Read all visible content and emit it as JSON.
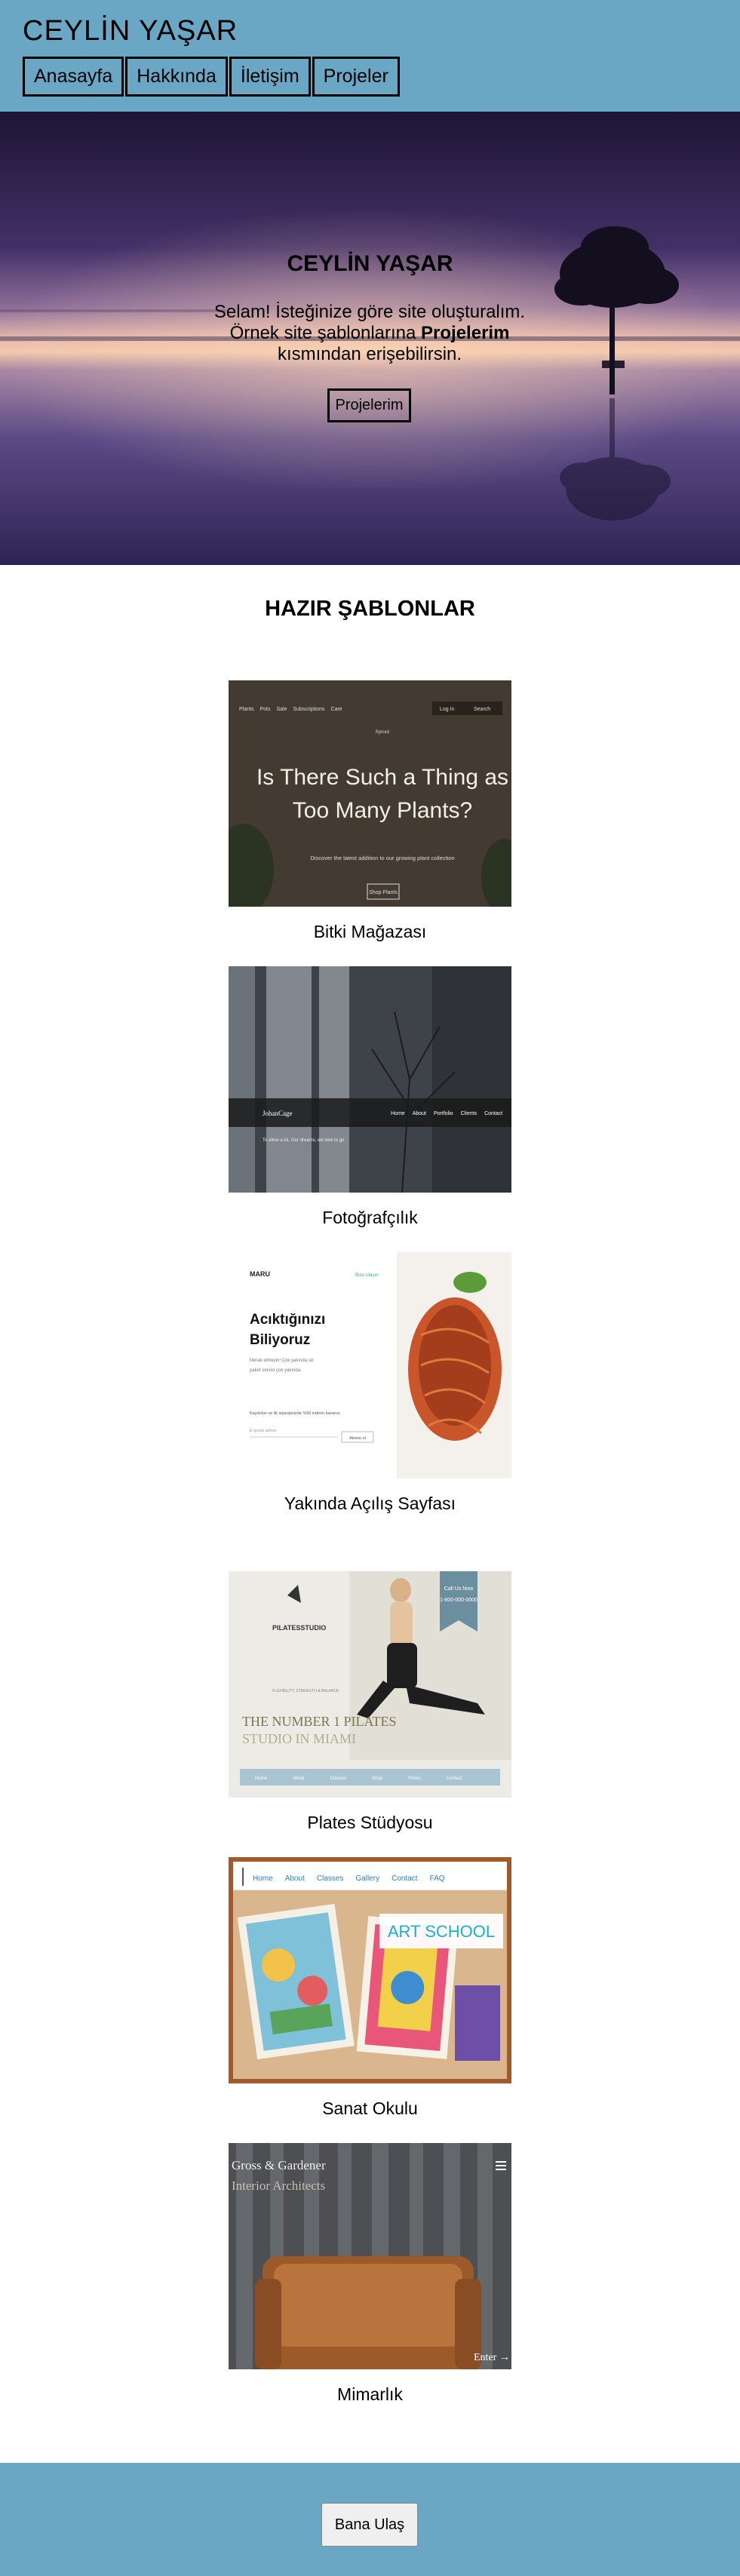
{
  "header": {
    "site_title": "CEYLİN YAŞAR",
    "nav": [
      "Anasayfa",
      "Hakkında",
      "İletişim",
      "Projeler"
    ]
  },
  "hero": {
    "title": "CEYLİN YAŞAR",
    "text_before": "Selam! İsteğinize göre site oluşturalım. Örnek site şablonlarına ",
    "text_bold": "Projelerim",
    "text_after": " kısmından erişebilirsin.",
    "button": "Projelerim"
  },
  "templates": {
    "title": "HAZIR ŞABLONLAR",
    "items": [
      {
        "label": "Bitki Mağazası",
        "nav": [
          "Plants",
          "Pots",
          "Sale",
          "Subscriptions",
          "Care"
        ],
        "brand": "Sprout",
        "login": "Log In",
        "search": "Search",
        "headline1": "Is There Such a Thing as",
        "headline2": "Too Many Plants?",
        "sub": "Discover the latest addition to our growing plant collection",
        "cta": "Shop Plants"
      },
      {
        "label": "Fotoğrafçılık",
        "brand": "JohanCage",
        "nav": [
          "Home",
          "About",
          "Portfolio",
          "Clients",
          "Contact"
        ],
        "tagline": "To allow a lot. Our dreams, we love to go"
      },
      {
        "label": "Yakında Açılış Sayfası",
        "brand": "MARU",
        "top_link": "Bize Ulaşın",
        "heading1": "Acıktığınızı",
        "heading2": "Biliyoruz",
        "desc1": "Merak etmeyin! Çok yakında siz",
        "desc2": "paket servisi çok yakında.",
        "note": "Kaydolun ve ilk siparişinizde %50 indirim kazanın",
        "email": "E-posta adresi",
        "submit": "Abone ol"
      },
      {
        "label": "Plates Stüdyosu",
        "brand": "PILATESSTUDIO",
        "call1": "Call Us Now",
        "call2": "1-800-000-0000",
        "small": "FLEXIBILITY, STRENGTH & BALANCE",
        "headline1": "THE NUMBER 1 PILATES",
        "headline2": "STUDIO IN MIAMI",
        "tabs": [
          "Home",
          "About",
          "Classes",
          "Shop",
          "Prices",
          "Contact"
        ]
      },
      {
        "label": "Sanat Okulu",
        "nav": [
          "Home",
          "About",
          "Classes",
          "Gallery",
          "Contact",
          "FAQ"
        ],
        "banner": "ART SCHOOL"
      },
      {
        "label": "Mimarlık",
        "brand1": "Gross & Gardener",
        "brand2": "Interior Architects",
        "enter": "Enter →"
      }
    ]
  },
  "footer": {
    "button": "Bana Ulaş"
  },
  "colors": {
    "header_bg": "#6aa7c4",
    "footer_bg": "#6aa7c4"
  }
}
